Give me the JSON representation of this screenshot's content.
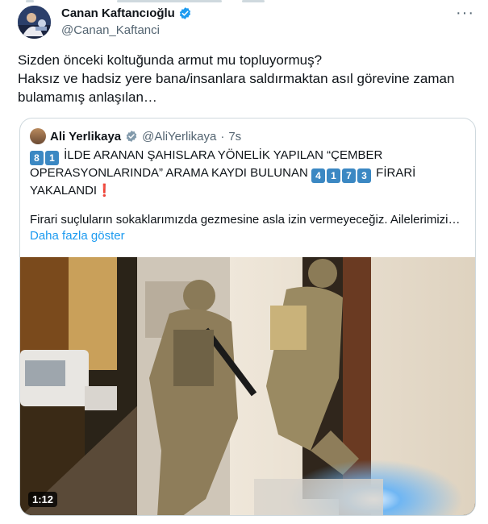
{
  "tweet": {
    "author_name": "Canan Kaftancıoğlu",
    "author_handle": "@Canan_Kaftanci",
    "more_label": "···",
    "text_lines": [
      "Sizden önceki koltuğunda armut mu topluyormuş?",
      "Haksız ve hadsiz yere bana/insanlara saldırmaktan asıl görevine zaman",
      "bulamamış anlaşılan…"
    ]
  },
  "quote": {
    "author_name": "Ali Yerlikaya",
    "author_handle": "@AliYerlikaya",
    "separator": "·",
    "time": "7s",
    "line1_digits": [
      "8",
      "1"
    ],
    "line1_text": "İLDE ARANAN ŞAHISLARA YÖNELİK YAPILAN “ÇEMBER",
    "line2_text": "OPERASYONLARINDA” ARAMA KAYDI BULUNAN",
    "line2_digits": [
      "4",
      "1",
      "7",
      "3"
    ],
    "line2_tail": "FİRARİ",
    "line3_text": "YAKALANDI",
    "line3_emoji": "❗",
    "summary": "Firari suçluların sokaklarımızda gezmesine asla izin vermeyeceğiz. Ailelerimizi…",
    "show_more": "Daha fazla göster",
    "video_duration": "1:12"
  },
  "colors": {
    "link": "#1d9bf0",
    "verified": "#1d9bf0",
    "keycap": "#3b88c3",
    "muted": "#536471",
    "border": "#cfd9de"
  },
  "icons": [
    "verified-badge-icon",
    "more-options-icon"
  ]
}
